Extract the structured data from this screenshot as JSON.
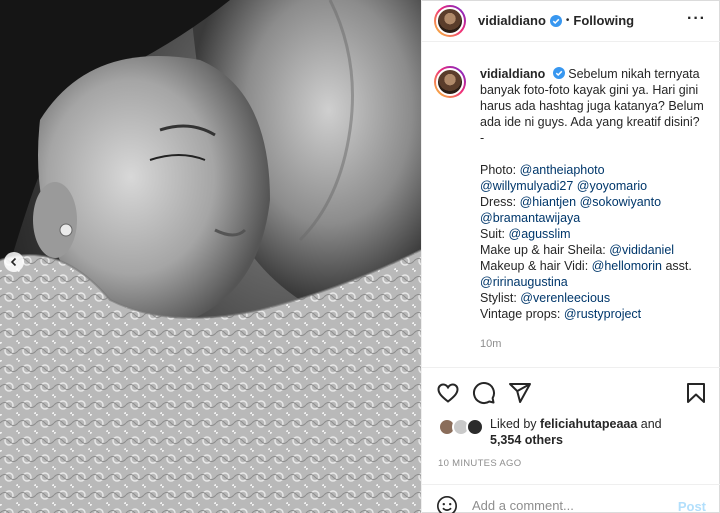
{
  "header": {
    "username": "vidialdiano",
    "separator": "•",
    "follow_status": "Following",
    "more_icon": "more-horizontal-icon"
  },
  "caption": {
    "username": "vidialdiano",
    "text_lines": [
      "Sebelum nikah ternyata",
      "banyak foto-foto kayak gini ya. Hari gini",
      "harus ada hashtag juga katanya? Belum",
      "ada ide ni guys. Ada yang kreatif disini?",
      "-"
    ],
    "credits": [
      {
        "label": "Photo: ",
        "handles": [
          "@antheiaphoto"
        ]
      },
      {
        "label": "",
        "handles": [
          "@willymulyadi27",
          "@yoyomario"
        ]
      },
      {
        "label": "Dress: ",
        "handles": [
          "@hiantjen",
          "@sokowiyanto"
        ]
      },
      {
        "label": "",
        "handles": [
          "@bramantawijaya"
        ]
      },
      {
        "label": "Suit: ",
        "handles": [
          "@agusslim"
        ]
      },
      {
        "label": "Make up & hair Sheila: ",
        "handles": [
          "@vididaniel"
        ]
      },
      {
        "label": "Makeup & hair Vidi: ",
        "handles": [
          "@hellomorin"
        ],
        "suffix": " asst."
      },
      {
        "label": "",
        "handles": [
          "@ririnaugustina"
        ]
      },
      {
        "label": "Stylist: ",
        "handles": [
          "@verenleecious"
        ]
      },
      {
        "label": "Vintage props: ",
        "handles": [
          "@rustyproject"
        ]
      }
    ],
    "time": "10m"
  },
  "likes": {
    "prefix": "Liked by ",
    "user": "feliciahutapeaaa",
    "suffix": " and",
    "others": "5,354 others"
  },
  "posted_ago": "10 MINUTES AGO",
  "comment": {
    "placeholder": "Add a comment...",
    "post_label": "Post"
  },
  "colors": {
    "link": "#00376b",
    "post_disabled": "#b2dffc",
    "muted": "#8e8e8e"
  }
}
